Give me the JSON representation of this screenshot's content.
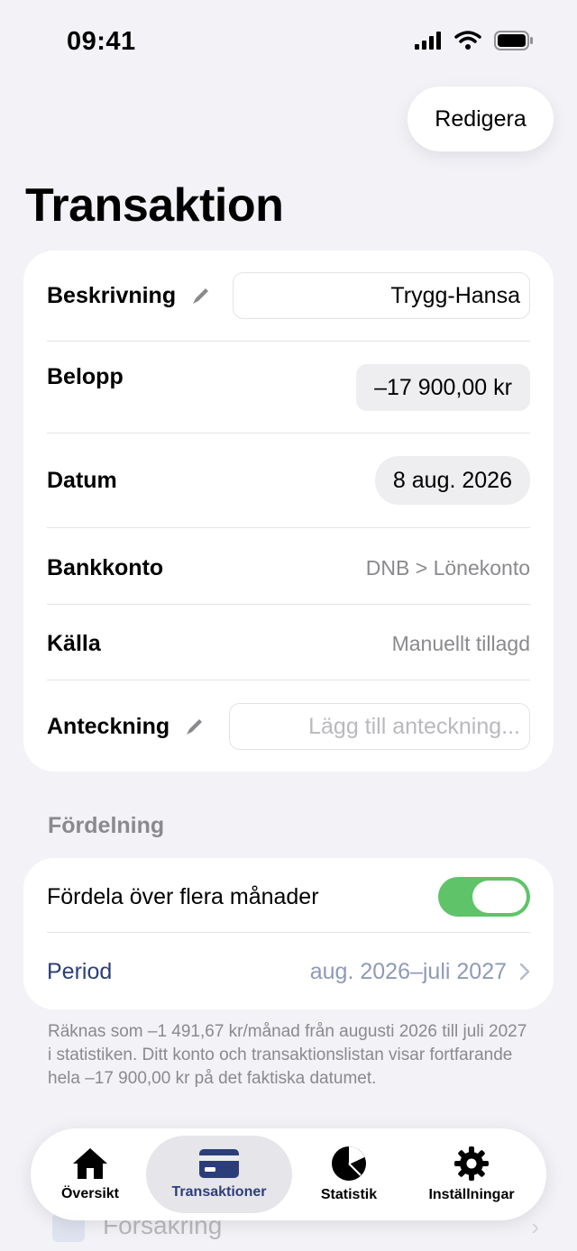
{
  "status_bar": {
    "time": "09:41"
  },
  "header": {
    "edit_label": "Redigera",
    "title": "Transaktion"
  },
  "details": {
    "description": {
      "label": "Beskrivning",
      "value": "Trygg-Hansa"
    },
    "amount": {
      "label": "Belopp",
      "value": "–17 900,00 kr"
    },
    "date": {
      "label": "Datum",
      "value": "8 aug. 2026"
    },
    "account": {
      "label": "Bankkonto",
      "value": "DNB > Lönekonto"
    },
    "source": {
      "label": "Källa",
      "value": "Manuellt tillagd"
    },
    "note": {
      "label": "Anteckning",
      "placeholder": "Lägg till anteckning..."
    }
  },
  "distribution": {
    "header": "Fördelning",
    "toggle_label": "Fördela över flera månader",
    "toggle_on": true,
    "period_label": "Period",
    "period_value": "aug. 2026–juli 2027",
    "footnote": "Räknas som –1 491,67 kr/månad från augusti 2026 till juli 2027 i statistiken. Ditt konto och transaktionslistan visar fortfarande hela –17 900,00 kr på det faktiska datumet."
  },
  "background_row": {
    "label": "Försäkring"
  },
  "tabs": [
    {
      "label": "Översikt",
      "icon": "house-icon",
      "active": false
    },
    {
      "label": "Transaktioner",
      "icon": "card-icon",
      "active": true
    },
    {
      "label": "Statistik",
      "icon": "pie-chart-icon",
      "active": false
    },
    {
      "label": "Inställningar",
      "icon": "gear-icon",
      "active": false
    }
  ],
  "colors": {
    "accent": "#2c3e7a",
    "toggle_on": "#5fc36a",
    "background": "#f2f2f7"
  }
}
